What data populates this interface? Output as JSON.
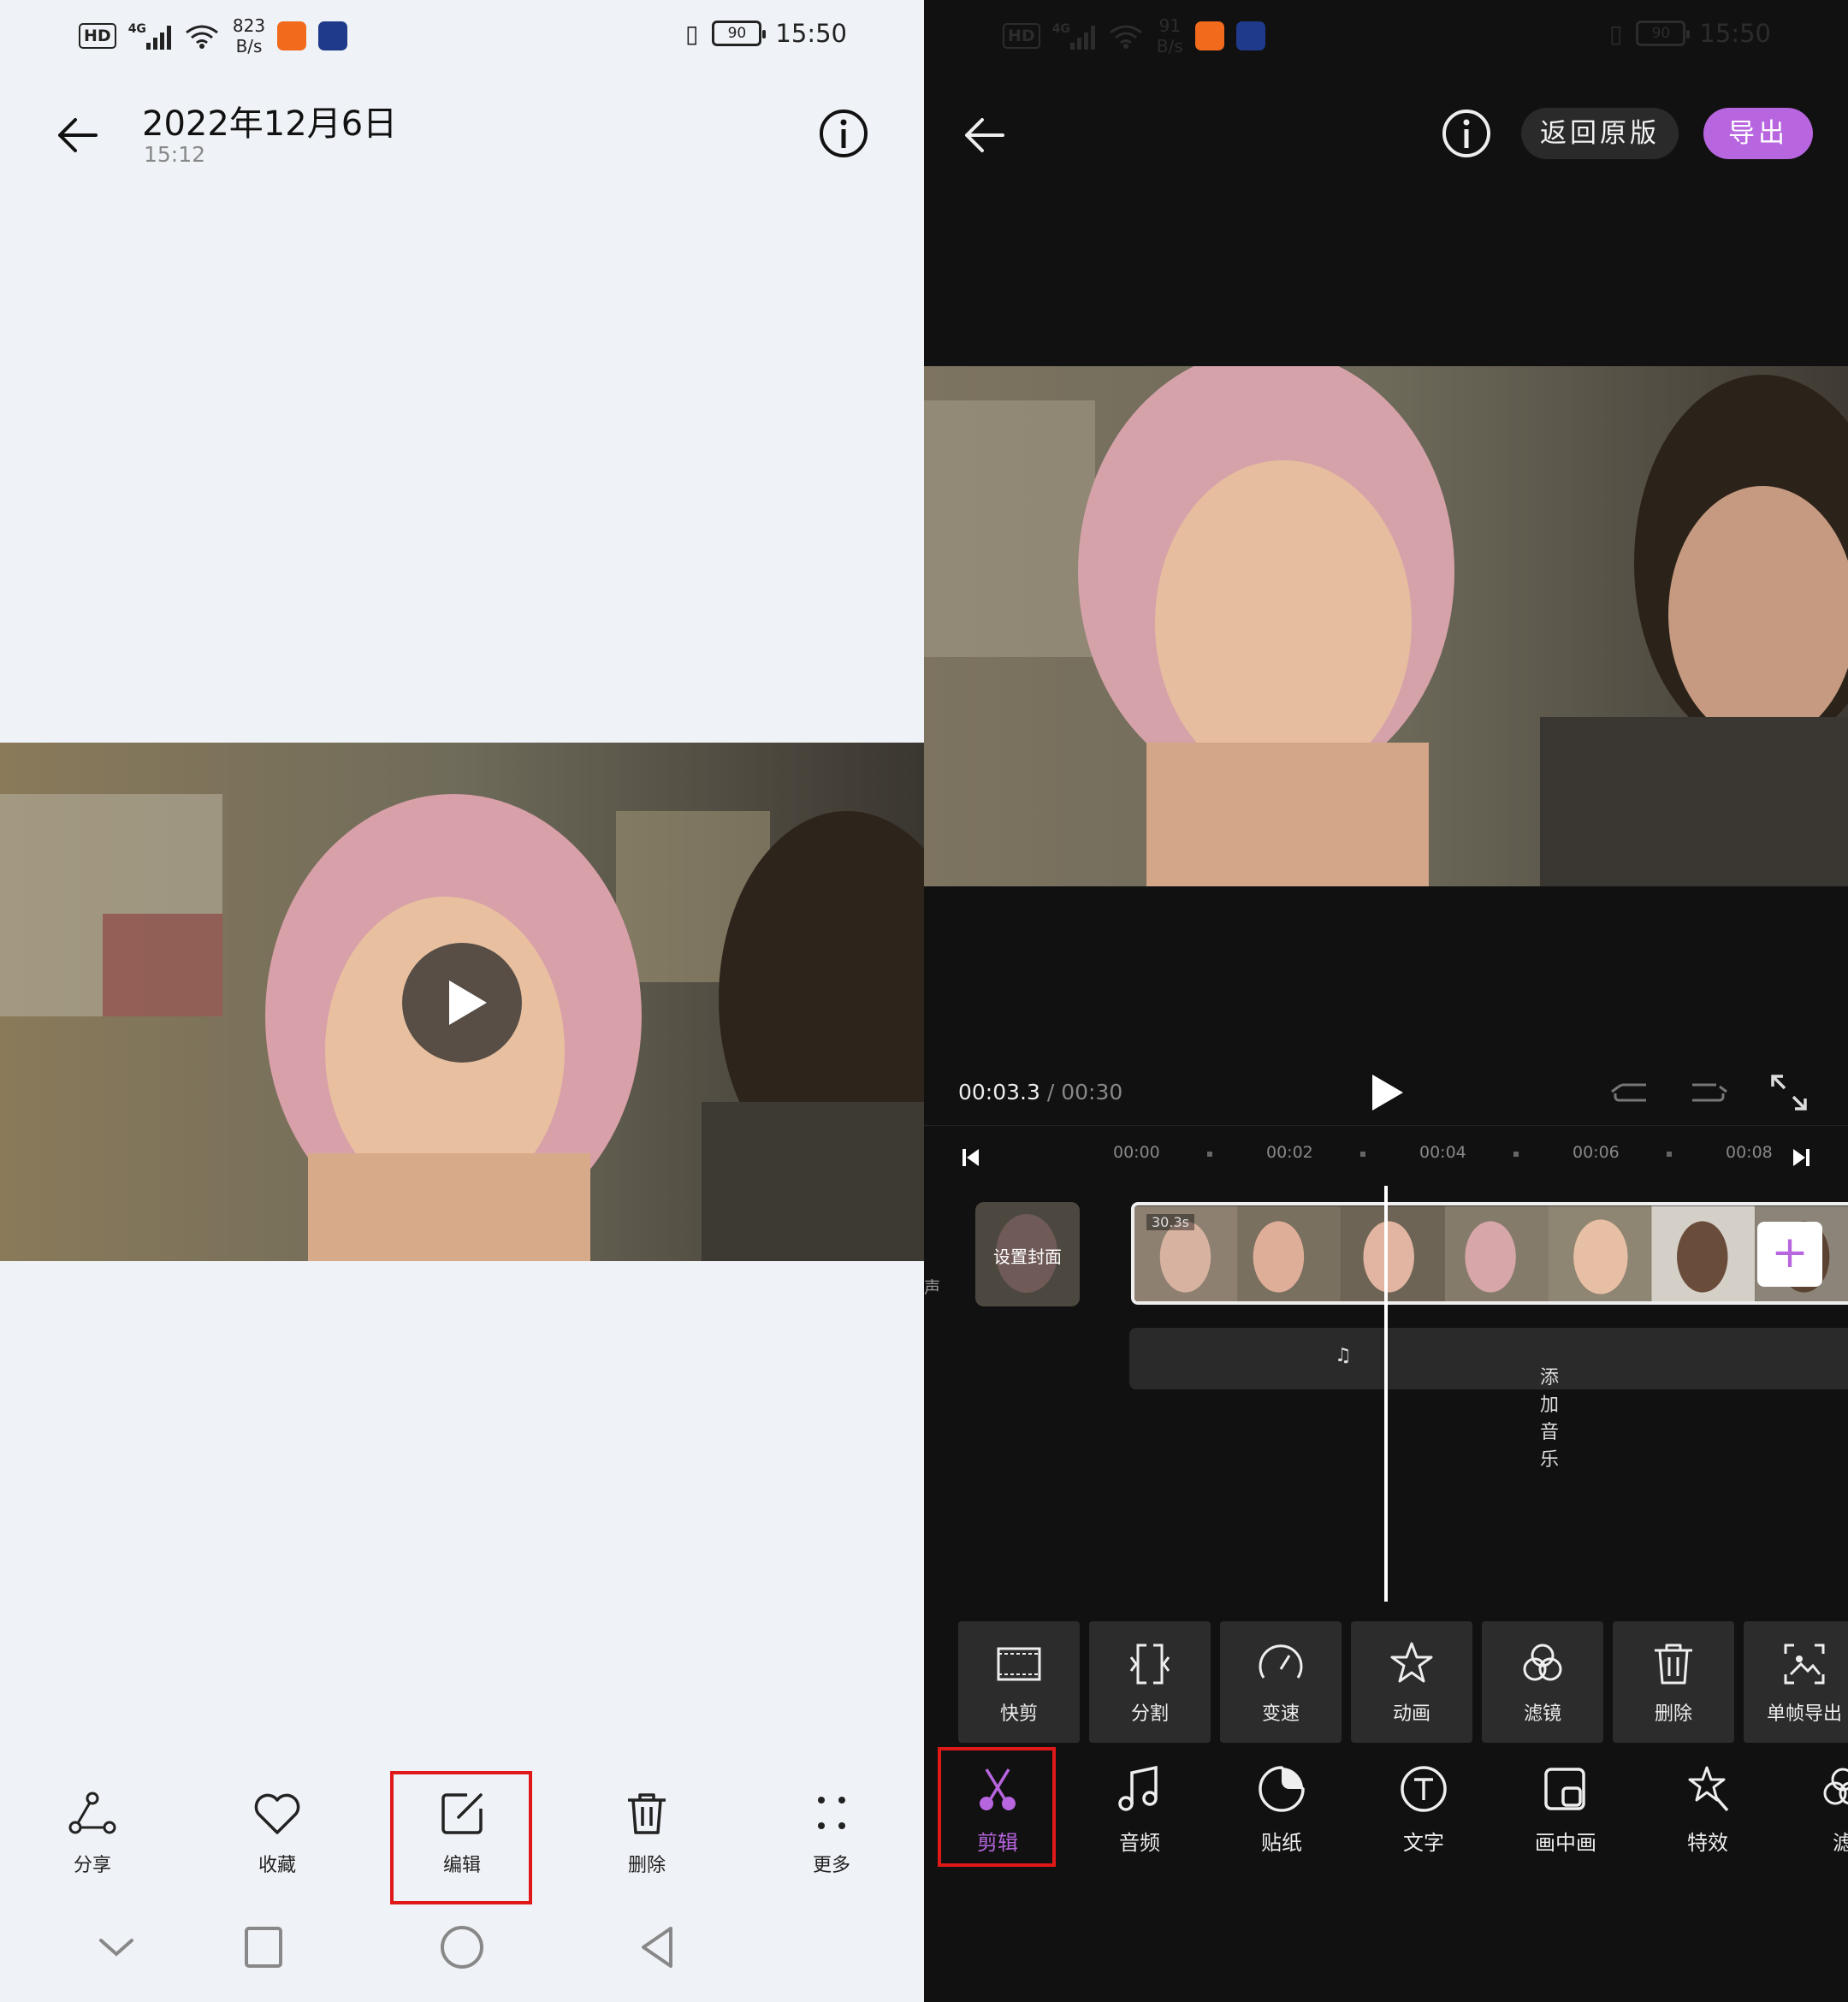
{
  "left": {
    "status": {
      "network": "4G",
      "speed_value": "823",
      "speed_unit": "B/s",
      "battery": "90",
      "time": "15:50"
    },
    "header": {
      "title": "2022年12月6日",
      "subtitle": "15:12"
    },
    "toolbar": [
      {
        "label": "分享",
        "icon": "share-icon"
      },
      {
        "label": "收藏",
        "icon": "heart-icon"
      },
      {
        "label": "编辑",
        "icon": "edit-icon",
        "highlighted": true
      },
      {
        "label": "删除",
        "icon": "trash-icon"
      },
      {
        "label": "更多",
        "icon": "more-icon"
      }
    ]
  },
  "right": {
    "status": {
      "network": "4G",
      "speed_value": "91",
      "speed_unit": "B/s",
      "battery": "90",
      "time": "15:50"
    },
    "header": {
      "revert_label": "返回原版",
      "export_label": "导出"
    },
    "player": {
      "current": "00:03.3",
      "separator": "/",
      "total": "00:30"
    },
    "timeline": {
      "ticks": [
        "00:00",
        "00:02",
        "00:04",
        "00:06",
        "00:08"
      ],
      "cover_label": "设置封面",
      "clip_duration": "30.3s",
      "music_label": "添加音乐",
      "side_label": "声"
    },
    "edit_tools": [
      {
        "label": "快剪",
        "icon": "film-frame-icon"
      },
      {
        "label": "分割",
        "icon": "split-icon"
      },
      {
        "label": "变速",
        "icon": "speed-gauge-icon"
      },
      {
        "label": "动画",
        "icon": "star-icon"
      },
      {
        "label": "滤镜",
        "icon": "filter-circles-icon"
      },
      {
        "label": "删除",
        "icon": "trash-icon"
      },
      {
        "label": "单帧导出",
        "icon": "frame-export-icon"
      }
    ],
    "tabs": [
      {
        "label": "剪辑",
        "icon": "scissors-icon",
        "active": true
      },
      {
        "label": "音频",
        "icon": "music-note-icon"
      },
      {
        "label": "贴纸",
        "icon": "sticker-icon"
      },
      {
        "label": "文字",
        "icon": "text-icon"
      },
      {
        "label": "画中画",
        "icon": "pip-icon"
      },
      {
        "label": "特效",
        "icon": "magic-wand-icon"
      },
      {
        "label": "滤",
        "icon": "filter-circles-icon"
      }
    ]
  },
  "colors": {
    "accent": "#b865e0",
    "highlight": "#e01818",
    "left_bg": "#eff2f6",
    "right_bg": "#111111"
  }
}
